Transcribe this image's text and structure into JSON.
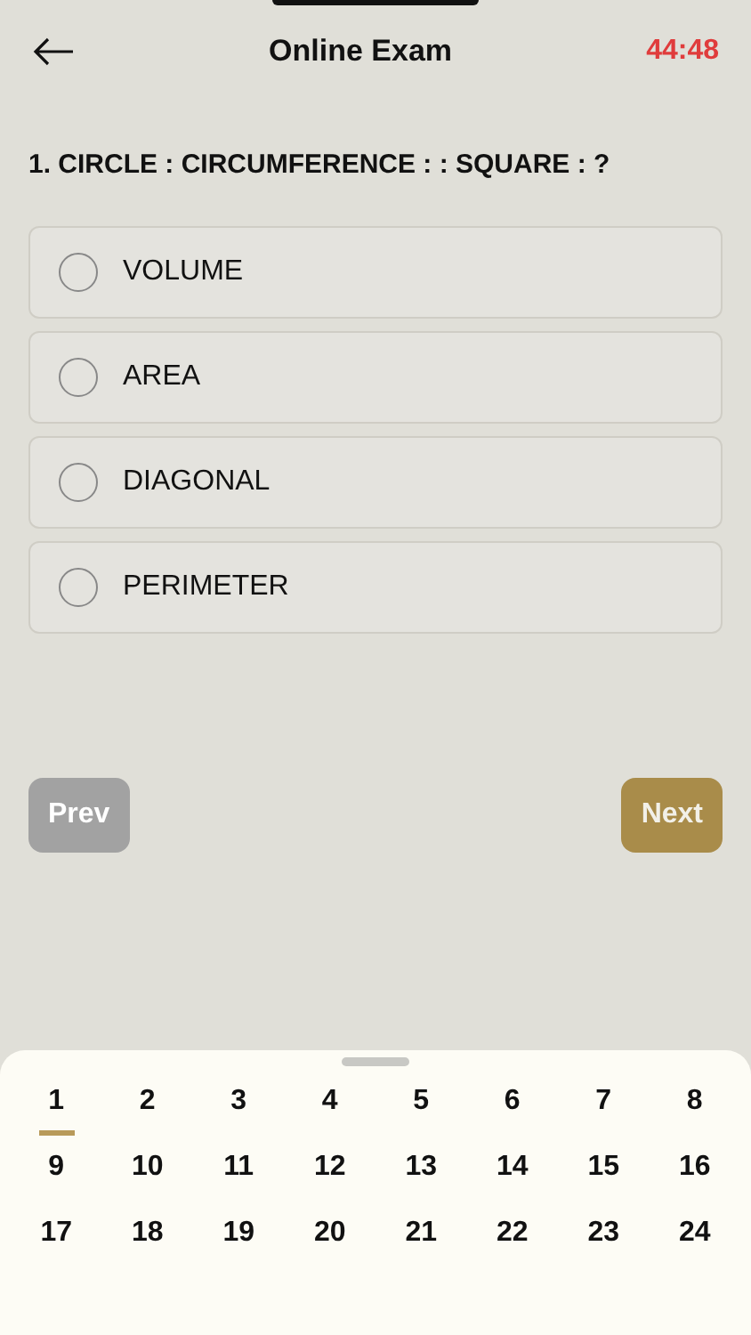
{
  "header": {
    "title": "Online Exam",
    "timer": "44:48"
  },
  "question": {
    "text": "1. CIRCLE : CIRCUMFERENCE : : SQUARE : ?",
    "options": [
      {
        "label": "VOLUME",
        "selected": false
      },
      {
        "label": "AREA",
        "selected": false
      },
      {
        "label": "DIAGONAL",
        "selected": false
      },
      {
        "label": "PERIMETER",
        "selected": false
      }
    ]
  },
  "navigation": {
    "prev": {
      "label": "Prev",
      "disabled": true
    },
    "next": {
      "label": "Next",
      "disabled": false
    }
  },
  "question_palette": [
    {
      "label": "1",
      "selected": true
    },
    {
      "label": "2",
      "selected": false
    },
    {
      "label": "3",
      "selected": false
    },
    {
      "label": "4",
      "selected": false
    },
    {
      "label": "5",
      "selected": false
    },
    {
      "label": "6",
      "selected": false
    },
    {
      "label": "7",
      "selected": false
    },
    {
      "label": "8",
      "selected": false
    },
    {
      "label": "9",
      "selected": false
    },
    {
      "label": "10",
      "selected": false
    },
    {
      "label": "11",
      "selected": false
    },
    {
      "label": "12",
      "selected": false
    },
    {
      "label": "13",
      "selected": false
    },
    {
      "label": "14",
      "selected": false
    },
    {
      "label": "15",
      "selected": false
    },
    {
      "label": "16",
      "selected": false
    },
    {
      "label": "17",
      "selected": false
    },
    {
      "label": "18",
      "selected": false
    },
    {
      "label": "19",
      "selected": false
    },
    {
      "label": "20",
      "selected": false
    },
    {
      "label": "21",
      "selected": false
    },
    {
      "label": "22",
      "selected": false
    },
    {
      "label": "23",
      "selected": false
    },
    {
      "label": "24",
      "selected": false
    }
  ]
}
